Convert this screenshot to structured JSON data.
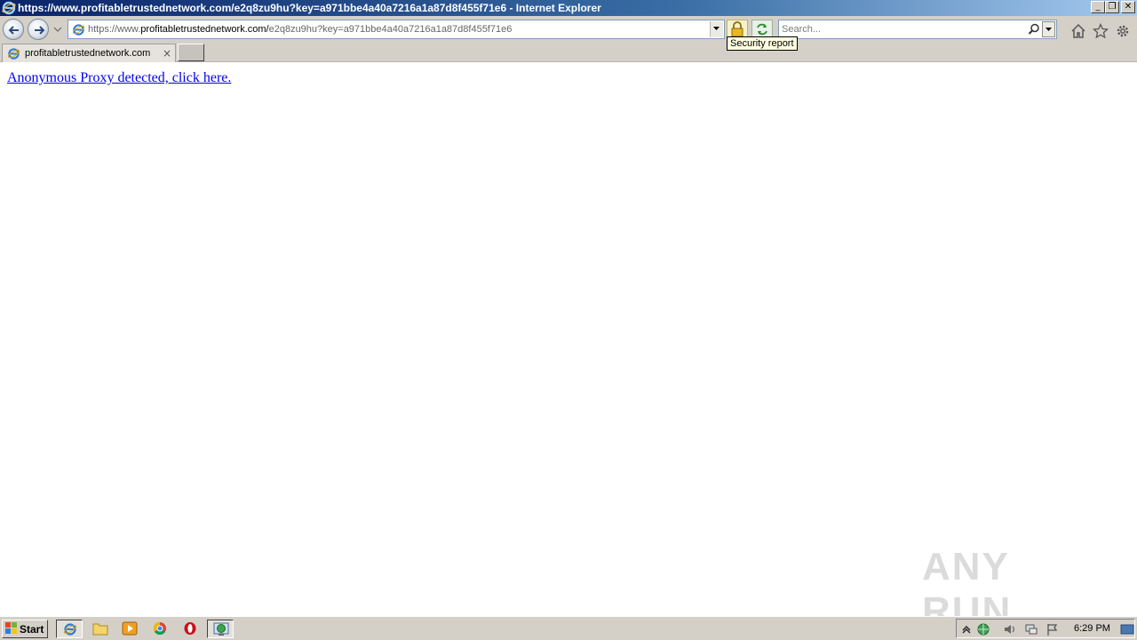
{
  "window": {
    "title": "https://www.profitabletrustednetwork.com/e2q8zu9hu?key=a971bbe4a40a7216a1a87d8f455f71e6 - Internet Explorer",
    "minimize_glyph": "_",
    "maximize_glyph": "❐",
    "close_glyph": "✕"
  },
  "address_bar": {
    "url_prefix": "https://www.",
    "url_domain": "profitabletrustednetwork.com/",
    "url_path": "e2q8zu9hu?key=a971bbe4a40a7216a1a87d8f455f71e6"
  },
  "tooltip": {
    "text": "Security report"
  },
  "search": {
    "placeholder": "Search..."
  },
  "tab": {
    "label": "profitabletrustednetwork.com",
    "close_glyph": "×"
  },
  "content": {
    "link_text": "Anonymous Proxy detected, click here."
  },
  "watermark": {
    "text": "ANY RUN"
  },
  "taskbar": {
    "start_label": "Start",
    "clock": "6:29 PM"
  },
  "icons": {
    "back": "back-arrow-icon",
    "forward": "forward-arrow-icon",
    "lock": "lock-icon",
    "refresh": "refresh-icon",
    "home": "home-icon",
    "favorites": "star-icon",
    "tools": "gear-icon"
  },
  "colors": {
    "titlebar_start": "#0a246a",
    "titlebar_end": "#a6caf0",
    "chrome": "#d4d0c8",
    "link": "#0000ee",
    "tooltip_bg": "#ffffe1"
  }
}
